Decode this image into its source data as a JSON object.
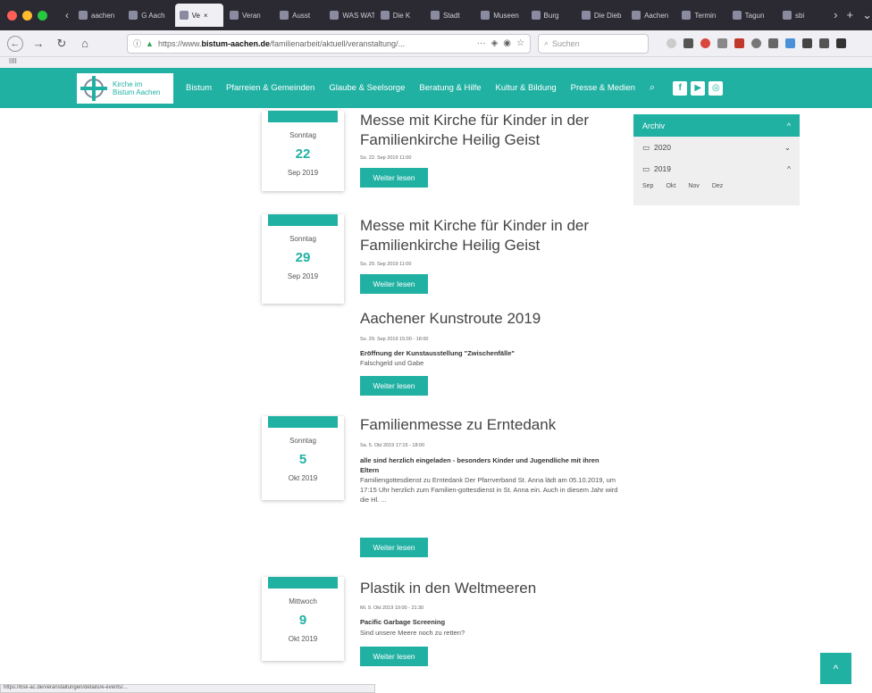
{
  "browser": {
    "tabs": [
      {
        "label": "aachen",
        "active": false
      },
      {
        "label": "G Aach",
        "active": false
      },
      {
        "label": "Ve",
        "active": true
      },
      {
        "label": "Veran",
        "active": false
      },
      {
        "label": "Ausst",
        "active": false
      },
      {
        "label": "WAS WAT",
        "active": false
      },
      {
        "label": "Die K",
        "active": false
      },
      {
        "label": "Stadt",
        "active": false
      },
      {
        "label": "Museen",
        "active": false
      },
      {
        "label": "Burg",
        "active": false
      },
      {
        "label": "Die Dieb",
        "active": false
      },
      {
        "label": "Aachen",
        "active": false
      },
      {
        "label": "Termin",
        "active": false
      },
      {
        "label": "Tagun",
        "active": false
      },
      {
        "label": "sbi",
        "active": false
      }
    ],
    "url_prefix": "https://www.",
    "url_host": "bistum-aachen.de",
    "url_path": "/familienarbeit/aktuell/veranstaltung/...",
    "search_placeholder": "Suchen",
    "bookmarks_label": "IIII",
    "status_url": "https://bsk-ac.de/veranstaltungen/details/e-events/..."
  },
  "site": {
    "logo_text_line1": "Kirche im",
    "logo_text_line2": "Bistum Aachen",
    "nav": [
      "Bistum",
      "Pfarreien & Gemeinden",
      "Glaube & Seelsorge",
      "Beratung & Hilfe",
      "Kultur & Bildung",
      "Presse & Medien"
    ],
    "accent_color": "#21b1a3"
  },
  "events": [
    {
      "weekday": "Sonntag",
      "day": "22",
      "month_year": "Sep 2019",
      "title": "Messe mit Kirche für Kinder in der Familienkirche Heilig Geist",
      "meta": "So. 22. Sep 2019 11:00",
      "subtitle": "",
      "text": "",
      "button": "Weiter lesen"
    },
    {
      "weekday": "Sonntag",
      "day": "29",
      "month_year": "Sep 2019",
      "title": "Messe mit Kirche für Kinder in der Familienkirche Heilig Geist",
      "meta": "So. 29. Sep 2019 11:00",
      "subtitle": "",
      "text": "",
      "button": "Weiter lesen"
    },
    {
      "weekday": "",
      "day": "",
      "month_year": "",
      "title": "Aachener Kunstroute 2019",
      "meta": "So. 29. Sep 2019 15:00 - 18:00",
      "subtitle": "Eröffnung der Kunstausstellung \"Zwischenfälle\"",
      "text": "Falschgeld und Gabe",
      "button": "Weiter lesen"
    },
    {
      "weekday": "Sonntag",
      "day": "5",
      "month_year": "Okt 2019",
      "title": "Familienmesse zu Erntedank",
      "meta": "Sa. 5. Okt 2019 17:15 - 18:00",
      "subtitle": "alle sind herzlich eingeladen - besonders Kinder und Jugendliche mit ihren Eltern",
      "text": "Familiengottesdienst zu Erntedank Der Pfarrverband St. Anna lädt am 05.10.2019, um 17:15 Uhr herzlich zum Familien-gottesdienst in St. Anna ein. Auch in diesem Jahr wird die Hl. ...",
      "button": "Weiter lesen"
    },
    {
      "weekday": "Mittwoch",
      "day": "9",
      "month_year": "Okt 2019",
      "title": "Plastik in den Weltmeeren",
      "meta": "Mi. 9. Okt 2019 19:00 - 21:30",
      "subtitle": "Pacific Garbage Screening",
      "text": "Sind unsere Meere noch zu retten?",
      "button": "Weiter lesen"
    }
  ],
  "archive": {
    "title": "Archiv",
    "years": [
      "2020",
      "2019"
    ],
    "months": [
      "Sep",
      "Okt",
      "Nov",
      "Dez"
    ]
  }
}
